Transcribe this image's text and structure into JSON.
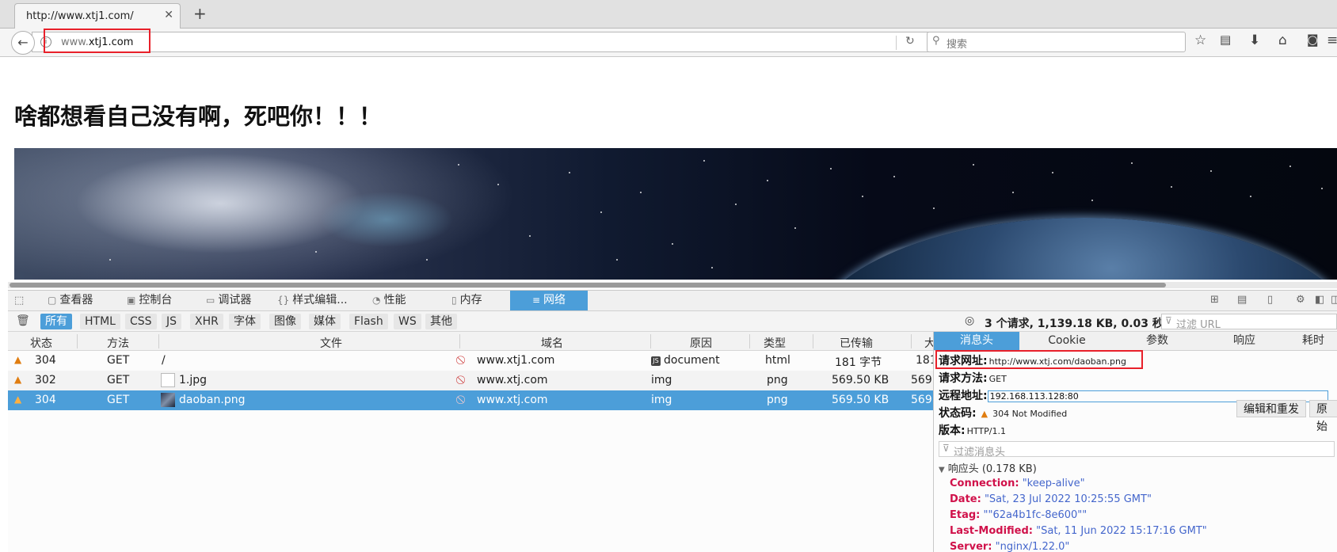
{
  "browser": {
    "tab_title": "http://www.xtj1.com/",
    "tab_close": "✕",
    "new_tab": "+",
    "url_prefix": "www.",
    "url_host": "xtj1.com",
    "search_placeholder": "搜索"
  },
  "page": {
    "heading": "啥都想看自己没有啊，死吧你！！！"
  },
  "devtools": {
    "tabs": [
      {
        "label": "查看器",
        "icon": "inspector-icon"
      },
      {
        "label": "控制台",
        "icon": "console-icon"
      },
      {
        "label": "调试器",
        "icon": "debugger-icon"
      },
      {
        "label": "样式编辑...",
        "icon": "style-editor-icon"
      },
      {
        "label": "性能",
        "icon": "performance-icon"
      },
      {
        "label": "内存",
        "icon": "memory-icon"
      },
      {
        "label": "网络",
        "icon": "network-icon"
      }
    ],
    "filters": [
      "所有",
      "HTML",
      "CSS",
      "JS",
      "XHR",
      "字体",
      "图像",
      "媒体",
      "Flash",
      "WS",
      "其他"
    ],
    "summary": "3 个请求, 1,139.18 KB, 0.03 秒",
    "url_filter_placeholder": "过滤 URL",
    "columns": [
      "状态",
      "方法",
      "文件",
      "域名",
      "原因",
      "类型",
      "已传输",
      "大"
    ],
    "rows": [
      {
        "status": "304",
        "method": "GET",
        "file": "/",
        "domain": "www.xtj1.com",
        "cause": "document",
        "type": "html",
        "transferred": "181 字节",
        "size": "181"
      },
      {
        "status": "302",
        "method": "GET",
        "file": "1.jpg",
        "domain": "www.xtj.com",
        "cause": "img",
        "type": "png",
        "transferred": "569.50 KB",
        "size": "569"
      },
      {
        "status": "304",
        "method": "GET",
        "file": "daoban.png",
        "domain": "www.xtj.com",
        "cause": "img",
        "type": "png",
        "transferred": "569.50 KB",
        "size": "569"
      }
    ],
    "details": {
      "tabs": [
        "消息头",
        "Cookie",
        "参数",
        "响应",
        "耗时"
      ],
      "request_url_label": "请求网址:",
      "request_url": "http://www.xtj.com/daoban.png",
      "method_label": "请求方法:",
      "method": "GET",
      "remote_label": "远程地址:",
      "remote": "192.168.113.128:80",
      "status_label": "状态码:",
      "status": "304  Not  Modified",
      "version_label": "版本:",
      "version": "HTTP/1.1",
      "edit_resend": "编辑和重发",
      "raw": "原始",
      "header_filter_placeholder": "过滤消息头",
      "response_headers_title": "响应头 (0.178 KB)",
      "headers": [
        {
          "key": "Connection:",
          "value": "\"keep-alive\""
        },
        {
          "key": "Date:",
          "value": "\"Sat, 23 Jul 2022 10:25:55 GMT\""
        },
        {
          "key": "Etag:",
          "value": "\"\"62a4b1fc-8e600\"\""
        },
        {
          "key": "Last-Modified:",
          "value": "\"Sat, 11 Jun 2022 15:17:16 GMT\""
        },
        {
          "key": "Server:",
          "value": "\"nginx/1.22.0\""
        }
      ]
    }
  },
  "colors": {
    "accent": "#4c9ed9",
    "highlight_box": "#e8202a",
    "warning": "#e07d10",
    "header_key": "#d0114a",
    "header_value": "#4466cc"
  }
}
